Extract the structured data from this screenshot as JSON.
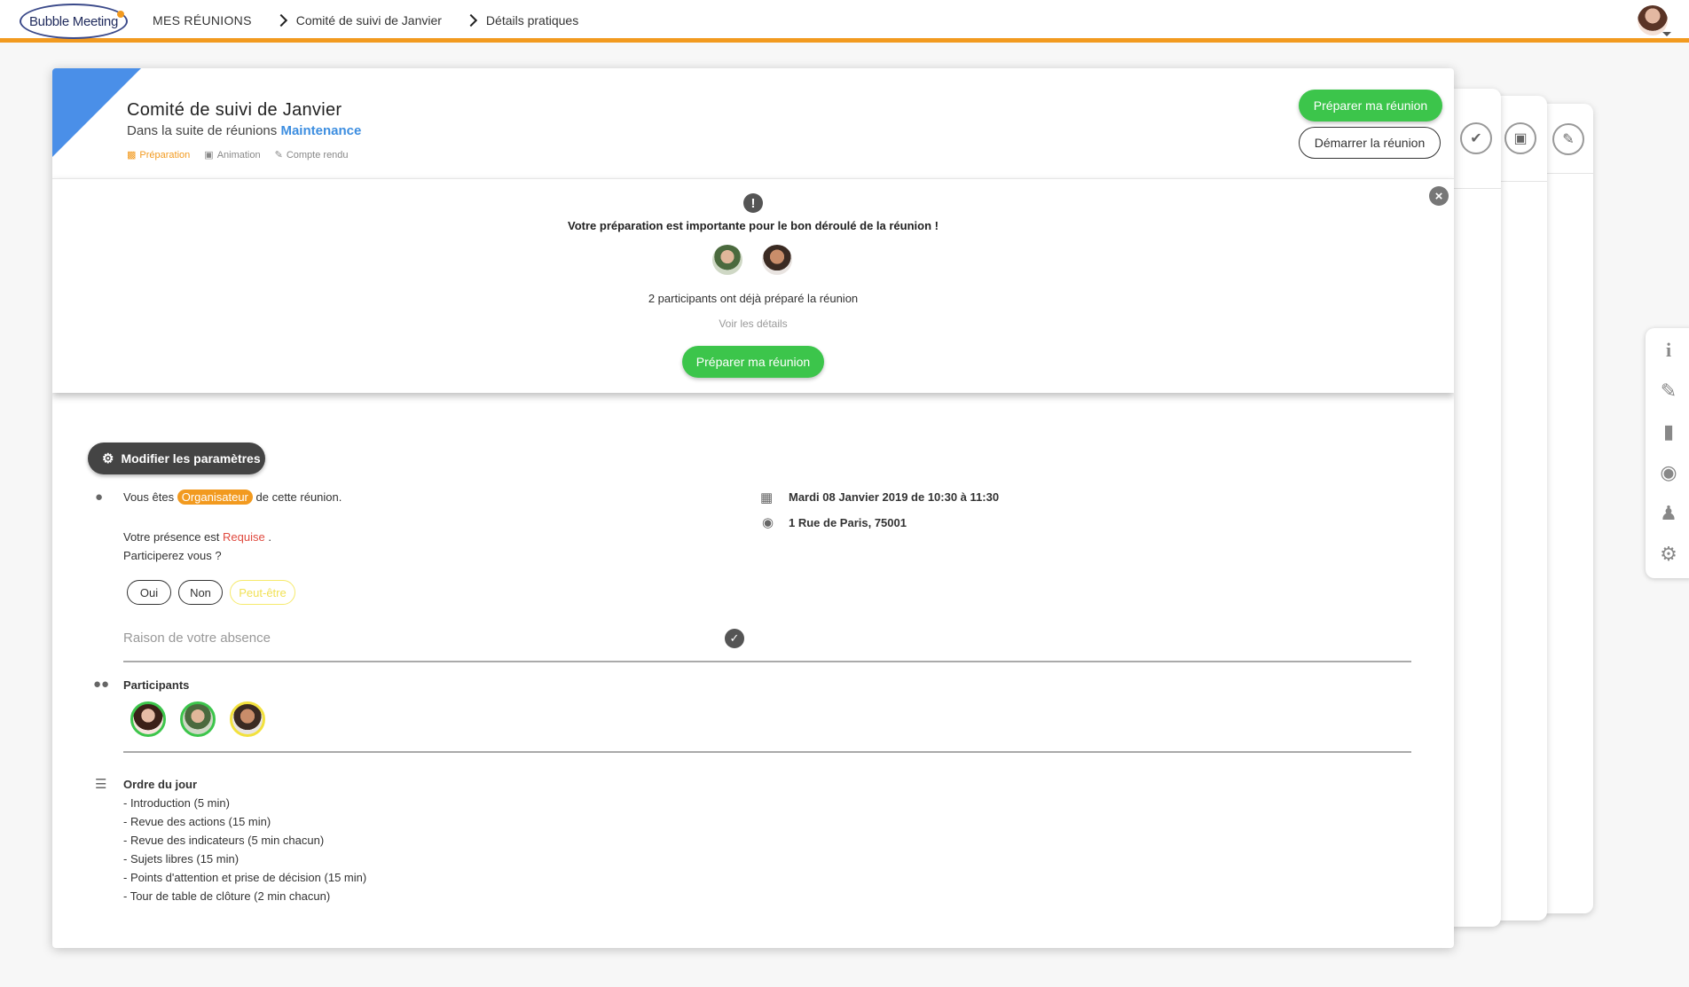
{
  "header": {
    "logo_text": "Bubble Meeting",
    "breadcrumbs": [
      "MES RÉUNIONS",
      "Comité de suivi de Janvier",
      "Détails pratiques"
    ]
  },
  "meeting": {
    "title": "Comité de suivi de Janvier",
    "suite_prefix": "Dans la suite de réunions",
    "suite_name": "Maintenance",
    "phases": [
      {
        "label": "Préparation",
        "icon": "clipboard-icon",
        "active": true
      },
      {
        "label": "Animation",
        "icon": "presentation-icon",
        "active": false
      },
      {
        "label": "Compte rendu",
        "icon": "report-icon",
        "active": false
      }
    ],
    "prepare_button": "Préparer ma réunion",
    "start_button": "Démarrer la réunion"
  },
  "prep_panel": {
    "message": "Votre préparation est importante pour le bon déroulé de la réunion !",
    "count_text": "2 participants ont déjà préparé la réunion",
    "details_link": "Voir les détails",
    "prepare_button": "Préparer ma réunion"
  },
  "details": {
    "settings_button": "Modifier les paramètres",
    "role_prefix": "Vous êtes",
    "role_badge": "Organisateur",
    "role_suffix": "de cette réunion.",
    "presence_prefix": "Votre présence est",
    "presence_status": "Requise",
    "presence_suffix": ".",
    "question": "Participerez vous ?",
    "options": [
      "Oui",
      "Non",
      "Peut-être"
    ],
    "absence_placeholder": "Raison de votre absence",
    "date_text": "Mardi 08 Janvier 2019 de 10:30 à 11:30",
    "address": "1 Rue de Paris, 75001",
    "participants_label": "Participants",
    "agenda_title": "Ordre du jour",
    "agenda_items": [
      "- Introduction (5 min)",
      "- Revue des actions (15 min)",
      "- Revue des indicateurs (5 min chacun)",
      "- Sujets libres (15 min)",
      "- Points d'attention et prise de décision (15 min)",
      "- Tour de table de clôture (2 min chacun)"
    ]
  },
  "colors": {
    "accent_orange": "#f29a1f",
    "green": "#3cc54b",
    "blue": "#4a8fe8",
    "link_blue": "#3d8ee0",
    "required_red": "#e04a3f"
  },
  "dock_icons": [
    "info-icon",
    "edit-icon",
    "folder-icon",
    "comments-icon",
    "users-icon",
    "gear-icon"
  ]
}
